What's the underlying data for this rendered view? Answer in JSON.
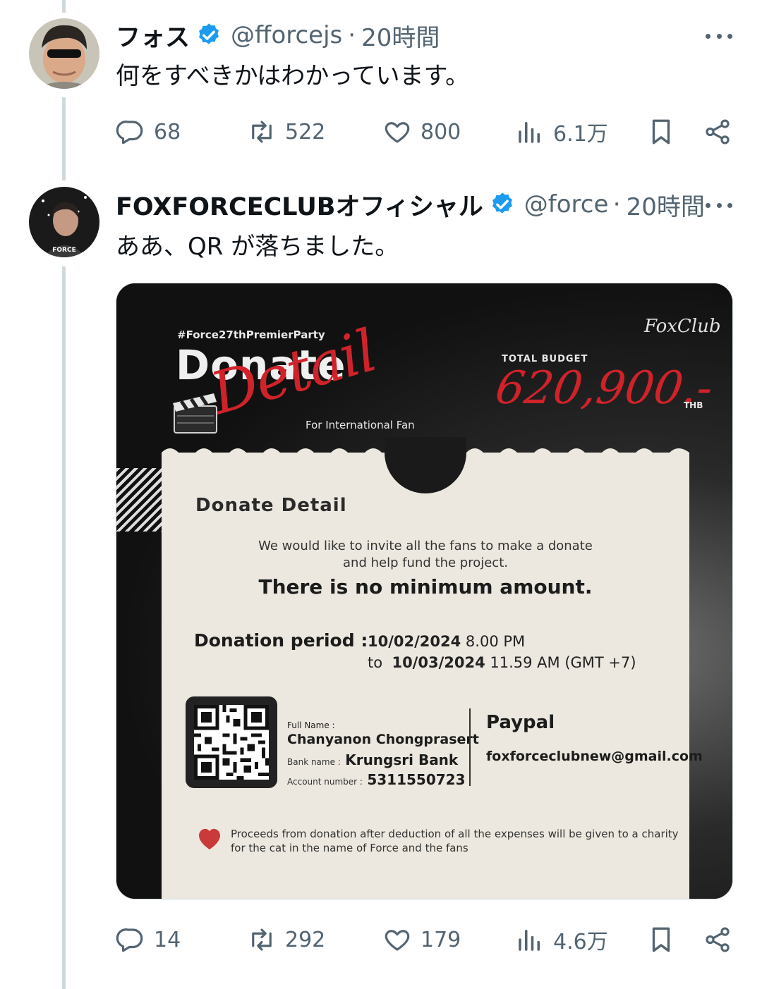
{
  "tweets": [
    {
      "display_name": "フォス",
      "handle": "@fforcejs",
      "time": "20時間",
      "text": "何をすべきかはわかっています。",
      "stats": {
        "replies": "68",
        "retweets": "522",
        "likes": "800",
        "views": "6.1万"
      }
    },
    {
      "display_name": "FOXFORCECLUBオフィシャル",
      "handle": "@force",
      "time": "20時間",
      "text": "ああ、QR が落ちました。",
      "stats": {
        "replies": "14",
        "retweets": "292",
        "likes": "179",
        "views": "4.6万"
      },
      "media": {
        "hashtag": "#Force27thPremierParty",
        "donate_word": "Donate",
        "detail_word": "Detail",
        "for_intl": "For International Fan",
        "club_logo": "FoxClub",
        "total_budget_label": "TOTAL BUDGET",
        "total_budget_amount": "620,900.-",
        "currency": "THB",
        "card_title": "Donate Detail",
        "invite_line1": "We would like to invite all the fans to make a donate",
        "invite_line2": "and help fund the project.",
        "no_minimum": "There is no minimum amount.",
        "period_label": "Donation period :",
        "period_start_date": "10/02/2024",
        "period_start_time": "8.00 PM",
        "period_to": "to",
        "period_end_date": "10/03/2024",
        "period_end_time": "11.59 AM (GMT +7)",
        "full_name_label": "Full Name :",
        "full_name": "Chanyanon Chongprasert",
        "bank_name_label": "Bank name :",
        "bank_name": "Krungsri Bank",
        "account_number_label": "Account number :",
        "account_number": "5311550723",
        "paypal_label": "Paypal",
        "paypal_email": "foxforceclubnew@gmail.com",
        "proceeds_line1": "Proceeds from donation after deduction of all the expenses will be given to a charity",
        "proceeds_line2": "for the cat in the name of Force and the fans"
      }
    }
  ],
  "colors": {
    "verified": "#1d9bf0",
    "muted": "#536471",
    "accent_red": "#d0222a",
    "thread_line": "#cfd9de"
  },
  "icons": [
    "reply-icon",
    "retweet-icon",
    "like-icon",
    "views-icon",
    "bookmark-icon",
    "share-icon",
    "verified-icon",
    "more-icon",
    "heart-icon",
    "qr-code"
  ]
}
